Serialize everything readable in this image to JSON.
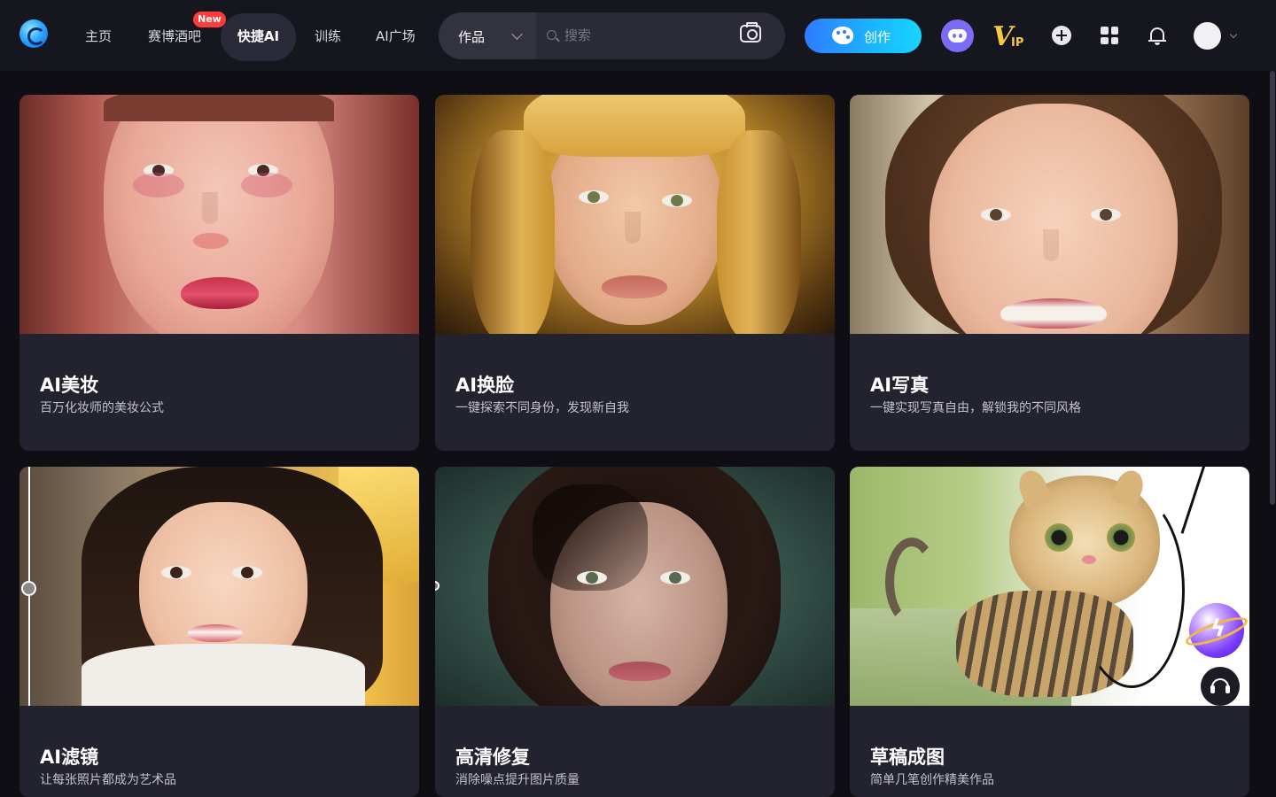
{
  "nav": {
    "items": [
      {
        "label": "主页"
      },
      {
        "label": "赛博酒吧",
        "badge": "New"
      },
      {
        "label": "快捷AI",
        "active": true
      },
      {
        "label": "训练"
      },
      {
        "label": "AI广场"
      }
    ]
  },
  "search": {
    "select_value": "作品",
    "placeholder": "搜索"
  },
  "actions": {
    "create_label": "创作"
  },
  "colors": {
    "accent": "#1ab7ff",
    "badge": "#ff3b3b",
    "discord": "#7b6cf6",
    "vip": "#f6c945"
  },
  "icons": [
    "logo",
    "chevron-down-icon",
    "search-icon",
    "camera-icon",
    "palette-icon",
    "discord-icon",
    "vip-icon",
    "plus-circle-icon",
    "apps-grid-icon",
    "bell-icon",
    "avatar",
    "headset-icon"
  ],
  "vip": {
    "letter": "V",
    "suffix": "IP"
  },
  "cards": [
    {
      "title": "AI美妆",
      "desc": "百万化妆师的美妆公式"
    },
    {
      "title": "AI换脸",
      "desc": "一键探索不同身份，发现新自我"
    },
    {
      "title": "AI写真",
      "desc": "一键实现写真自由，解锁我的不同风格"
    },
    {
      "title": "AI滤镜",
      "desc": "让每张照片都成为艺术品"
    },
    {
      "title": "高清修复",
      "desc": "消除噪点提升图片质量"
    },
    {
      "title": "草稿成图",
      "desc": "简单几笔创作精美作品"
    }
  ]
}
